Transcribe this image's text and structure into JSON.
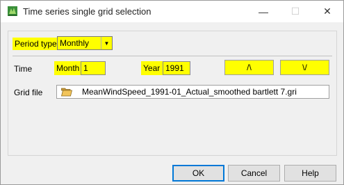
{
  "window": {
    "title": "Time series single grid selection",
    "controls": {
      "minimize": "—",
      "maximize": "☐",
      "close": "✕"
    }
  },
  "period": {
    "label": "Period type",
    "value": "Monthly",
    "arrow": "▼"
  },
  "time": {
    "label": "Time",
    "month_label": "Month",
    "month_value": "1",
    "year_label": "Year",
    "year_value": "1991",
    "up_label": "/\\",
    "down_label": "\\/"
  },
  "grid": {
    "label": "Grid file",
    "file_name": "MeanWindSpeed_1991-01_Actual_smoothed bartlett 7.gri"
  },
  "buttons": {
    "ok": "OK",
    "cancel": "Cancel",
    "help": "Help"
  },
  "colors": {
    "highlight": "#ffff00",
    "window_bg": "#f0f0f0",
    "ok_border": "#0078d7"
  },
  "icons": {
    "app": "app-icon",
    "folder": "folder-icon",
    "dropdown": "chevron-down-icon"
  }
}
